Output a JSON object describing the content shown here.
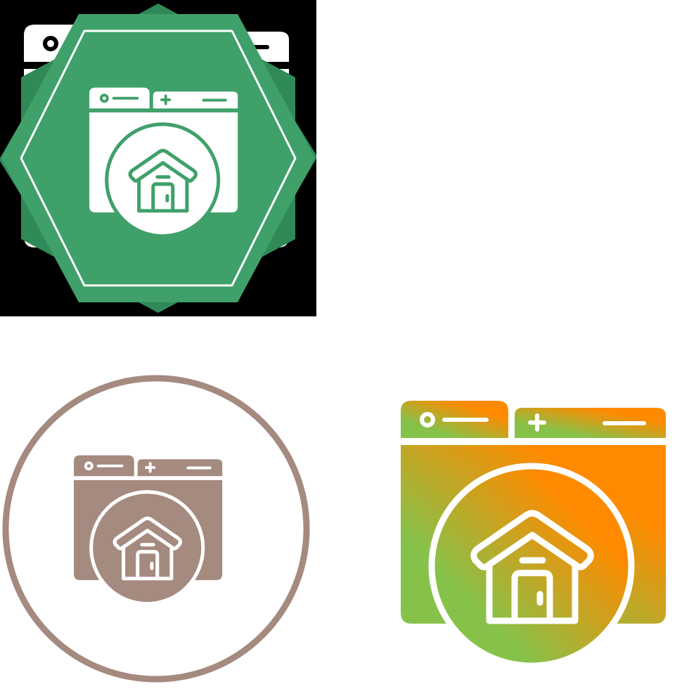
{
  "icon": {
    "name": "browser-home-icon",
    "variants": [
      {
        "id": "v-black",
        "name": "glyph-black-square",
        "style": "glyph",
        "background": "#000000",
        "fill": "#ffffff",
        "stroke": "#000000"
      },
      {
        "id": "v-green",
        "name": "glyph-green-badge",
        "style": "badge",
        "badge_back": "#2f8a58",
        "badge_front": "#40a06a",
        "fill": "#ffffff",
        "stroke": "#40a06a"
      },
      {
        "id": "v-brown",
        "name": "glyph-brown-circle",
        "style": "ring",
        "ring": "#a58a80",
        "fill": "#a58a80",
        "stroke": "#ffffff"
      },
      {
        "id": "v-grad",
        "name": "glyph-gradient",
        "style": "gradient",
        "gradient_from": "#86c24a",
        "gradient_to": "#ff8a00",
        "stroke": "#ffffff"
      }
    ]
  }
}
